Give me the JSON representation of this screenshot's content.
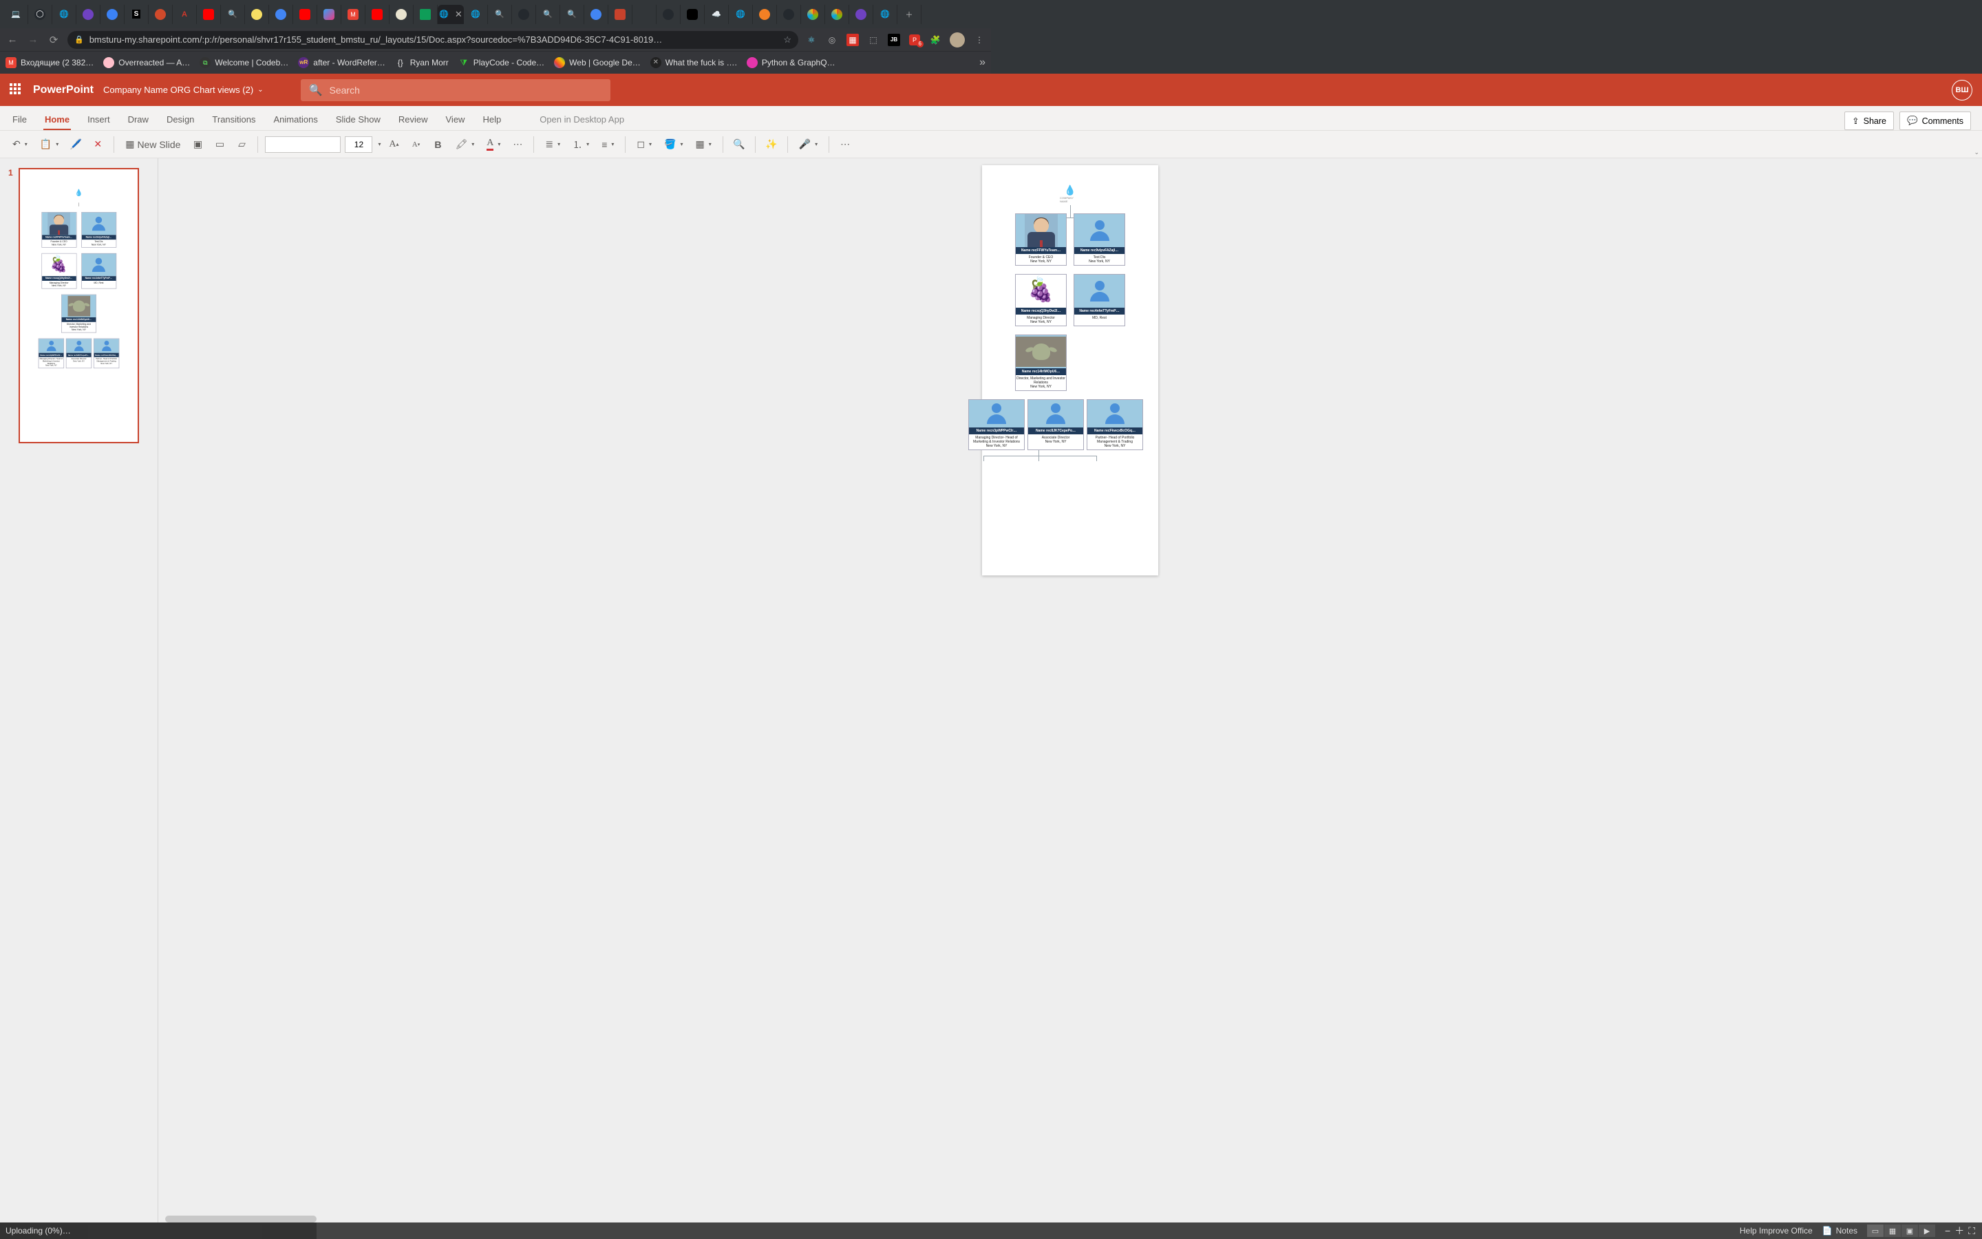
{
  "browser": {
    "url": "bmsturu-my.sharepoint.com/:p:/r/personal/shvr17r155_student_bmstu_ru/_layouts/15/Doc.aspx?sourcedoc=%7B3ADD94D6-35C7-4C91-8019…",
    "bookmarks": [
      {
        "label": "Входящие (2 382…",
        "icon": "gmail"
      },
      {
        "label": "Overreacted — A…",
        "icon": "pink"
      },
      {
        "label": "Welcome | Codeb…",
        "icon": "codeb"
      },
      {
        "label": "after - WordRefer…",
        "icon": "wr"
      },
      {
        "label": "Ryan Morr",
        "icon": "braces"
      },
      {
        "label": "PlayCode - Code…",
        "icon": "play"
      },
      {
        "label": "Web  |  Google De…",
        "icon": "gdev"
      },
      {
        "label": "What the fuck is ….",
        "icon": "wtf"
      },
      {
        "label": "Python & GraphQ…",
        "icon": "graph"
      }
    ],
    "ext_badge": "6"
  },
  "app": {
    "name": "PowerPoint",
    "doc": "Company Name ORG Chart views (2)",
    "search_placeholder": "Search",
    "user_initials": "ВШ",
    "tabs": [
      "File",
      "Home",
      "Insert",
      "Draw",
      "Design",
      "Transitions",
      "Animations",
      "Slide Show",
      "Review",
      "View",
      "Help"
    ],
    "tabs_active": "Home",
    "open_desktop": "Open in Desktop App",
    "share": "Share",
    "comments": "Comments",
    "new_slide": "New Slide",
    "font_size": "12",
    "slide_num": "1"
  },
  "status": {
    "upload": "Uploading (0%)…",
    "help": "Help Improve Office",
    "notes": "Notes"
  },
  "org": {
    "company": "COMPANY NAME",
    "cards": {
      "r1a": {
        "name": "Name recFFWYuTeam…",
        "title": "Founder & CEO",
        "loc": "New York, NY"
      },
      "r1b": {
        "name": "Name rec9vlpvFAZajI…",
        "title": "Test Dis",
        "loc": "New York, NY"
      },
      "r2a": {
        "name": "Name recxqQ3hyDw2I…",
        "title": "Managing Director",
        "loc": "New York, NY"
      },
      "r2b": {
        "name": "Name rec4nfwTTyFmP…",
        "title": "MD, Rest",
        "loc": ""
      },
      "r3a": {
        "name": "Name rec14IrlMOpU6…",
        "title": "Director, Marketing and Investor Relations",
        "loc": "New York, NY"
      },
      "r4a": {
        "name": "Name recn3pWPPwCIr…",
        "title": "Managing Director- Head of Marketing & Investor Relations",
        "loc": "New York, NY"
      },
      "r4b": {
        "name": "Name rec8JK7CepePo…",
        "title": "Associate Director",
        "loc": "New York, NY"
      },
      "r4c": {
        "name": "Name recFkwcxBcOGq…",
        "title": "Partner- Head of Portfolio Management & Trading",
        "loc": "New York, NY"
      }
    }
  }
}
